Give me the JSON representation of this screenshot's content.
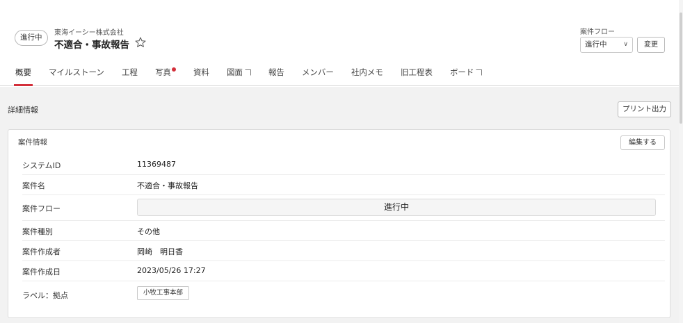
{
  "header": {
    "status": "進行中",
    "company": "東海イーシー株式会社",
    "title": "不適合・事故報告",
    "flow_label": "案件フロー",
    "flow_value": "進行中",
    "change_label": "変更"
  },
  "tabs": [
    {
      "label": "概要",
      "active": true
    },
    {
      "label": "マイルストーン"
    },
    {
      "label": "工程"
    },
    {
      "label": "写真"
    },
    {
      "label": "資料"
    },
    {
      "label": "図面"
    },
    {
      "label": "報告"
    },
    {
      "label": "メンバー"
    },
    {
      "label": "社内メモ"
    },
    {
      "label": "旧工程表"
    },
    {
      "label": "ボード"
    }
  ],
  "section": {
    "title": "詳細情報",
    "print_label": "プリント出力"
  },
  "card": {
    "title": "案件情報",
    "edit_label": "編集する",
    "rows": [
      {
        "key": "システムID",
        "value": "11369487"
      },
      {
        "key": "案件名",
        "value": "不適合・事故報告"
      },
      {
        "key": "案件フロー",
        "value": "進行中"
      },
      {
        "key": "案件種別",
        "value": "その他"
      },
      {
        "key": "案件作成者",
        "value": "岡崎　明日香"
      },
      {
        "key": "案件作成日",
        "value": "2023/05/26 17:27"
      },
      {
        "key": "ラベル：拠点",
        "value": "小牧工事本部"
      }
    ]
  },
  "colors": {
    "accent": "#d32f3a",
    "background": "#f2f2f2"
  }
}
